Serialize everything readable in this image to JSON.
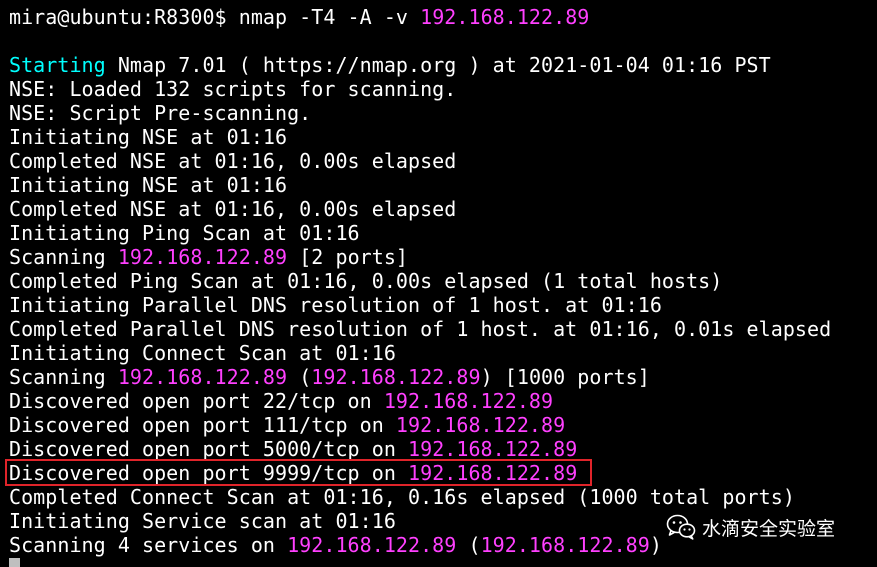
{
  "terminal": {
    "lines": [
      [
        {
          "t": "mira@ubuntu:R8300$ nmap -T4 -A -v ",
          "c": "white"
        },
        {
          "t": "192.168.122.89",
          "c": "ip"
        }
      ],
      [
        {
          "t": "",
          "c": "white"
        }
      ],
      [
        {
          "t": "Starting",
          "c": "cyan"
        },
        {
          "t": " Nmap 7.01 ( https://nmap.org ) at 2021-01-04 01:16 PST",
          "c": "white"
        }
      ],
      [
        {
          "t": "NSE: Loaded 132 scripts for scanning.",
          "c": "white"
        }
      ],
      [
        {
          "t": "NSE: Script Pre-scanning.",
          "c": "white"
        }
      ],
      [
        {
          "t": "Initiating NSE at 01:16",
          "c": "white"
        }
      ],
      [
        {
          "t": "Completed NSE at 01:16, 0.00s elapsed",
          "c": "white"
        }
      ],
      [
        {
          "t": "Initiating NSE at 01:16",
          "c": "white"
        }
      ],
      [
        {
          "t": "Completed NSE at 01:16, 0.00s elapsed",
          "c": "white"
        }
      ],
      [
        {
          "t": "Initiating Ping Scan at 01:16",
          "c": "white"
        }
      ],
      [
        {
          "t": "Scanning ",
          "c": "white"
        },
        {
          "t": "192.168.122.89",
          "c": "ip"
        },
        {
          "t": " [2 ports]",
          "c": "white"
        }
      ],
      [
        {
          "t": "Completed Ping Scan at 01:16, 0.00s elapsed (1 total hosts)",
          "c": "white"
        }
      ],
      [
        {
          "t": "Initiating Parallel DNS resolution of 1 host. at 01:16",
          "c": "white"
        }
      ],
      [
        {
          "t": "Completed Parallel DNS resolution of 1 host. at 01:16, 0.01s elapsed",
          "c": "white"
        }
      ],
      [
        {
          "t": "Initiating Connect Scan at 01:16",
          "c": "white"
        }
      ],
      [
        {
          "t": "Scanning ",
          "c": "white"
        },
        {
          "t": "192.168.122.89",
          "c": "ip"
        },
        {
          "t": " (",
          "c": "white"
        },
        {
          "t": "192.168.122.89",
          "c": "ip"
        },
        {
          "t": ") [1000 ports]",
          "c": "white"
        }
      ],
      [
        {
          "t": "Discovered open port 22/tcp on ",
          "c": "white"
        },
        {
          "t": "192.168.122.89",
          "c": "ip"
        }
      ],
      [
        {
          "t": "Discovered open port 111/tcp on ",
          "c": "white"
        },
        {
          "t": "192.168.122.89",
          "c": "ip"
        }
      ],
      [
        {
          "t": "Discovered open port 5000/tcp on ",
          "c": "white"
        },
        {
          "t": "192.168.122.89",
          "c": "ip"
        }
      ],
      [
        {
          "t": "Discovered open port 9999/tcp on ",
          "c": "white"
        },
        {
          "t": "192.168.122.89",
          "c": "ip"
        }
      ],
      [
        {
          "t": "Completed Connect Scan at 01:16, 0.16s elapsed (1000 total ports)",
          "c": "white"
        }
      ],
      [
        {
          "t": "Initiating Service scan at 01:16",
          "c": "white"
        }
      ],
      [
        {
          "t": "Scanning 4 services on ",
          "c": "white"
        },
        {
          "t": "192.168.122.89",
          "c": "ip"
        },
        {
          "t": " (",
          "c": "white"
        },
        {
          "t": "192.168.122.89",
          "c": "ip"
        },
        {
          "t": ")",
          "c": "white"
        }
      ]
    ],
    "highlighted_line_index": 19
  },
  "watermark": {
    "text": "水滴安全实验室",
    "icon": "wechat-icon"
  },
  "colors": {
    "background": "#000000",
    "text": "#ffffff",
    "ip": "#ff40ff",
    "starting": "#00ffff",
    "highlight_border": "#e0242a",
    "cursor": "#bfbfbf"
  }
}
